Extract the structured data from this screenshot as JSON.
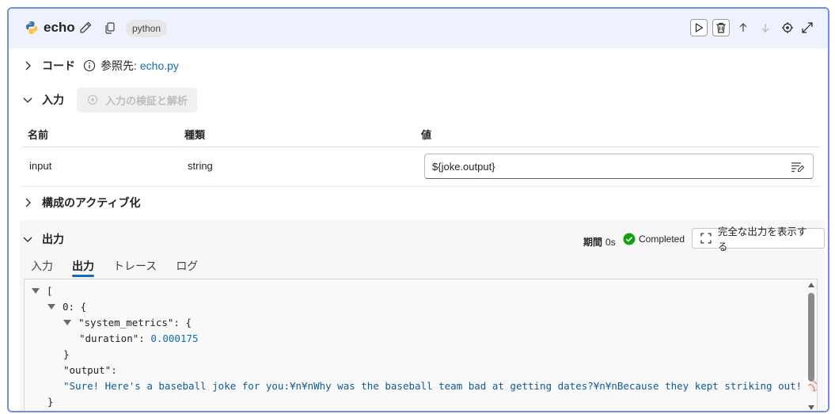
{
  "node": {
    "name": "echo",
    "language_badge": "python",
    "icons": [
      "python-logo",
      "pencil-icon",
      "copy-icon",
      "play-icon",
      "trash-icon",
      "arrow-up-icon",
      "arrow-down-icon",
      "target-icon",
      "expand-icon"
    ]
  },
  "code_section": {
    "title": "コード",
    "ref_label": "参照先:",
    "ref_link": "echo.py"
  },
  "input_section": {
    "title": "入力",
    "validate_button": "入力の検証と解析",
    "columns": {
      "name": "名前",
      "type": "種類",
      "value": "値"
    },
    "rows": [
      {
        "name": "input",
        "type": "string",
        "value": "${joke.output}"
      }
    ]
  },
  "config_section": {
    "title": "構成のアクティブ化"
  },
  "output_section": {
    "title": "出力",
    "duration_label": "期間",
    "duration_value": "0s",
    "status": "Completed",
    "status_color": "#13a10e",
    "full_output_button": "完全な出力を表示する",
    "tabs": [
      "入力",
      "出力",
      "トレース",
      "ログ"
    ],
    "active_tab": "出力",
    "json_view": {
      "open_bracket": "[",
      "index_key": "0:",
      "open_brace": "{",
      "system_metrics_key": "\"system_metrics\":",
      "sm_open_brace": "{",
      "duration_key": "\"duration\":",
      "duration_val": "0.000175",
      "sm_close_brace": "}",
      "output_key": "\"output\":",
      "output_val": "\"Sure! Here's a baseball joke for you:¥n¥nWhy was the baseball team bad at getting dates?¥n¥nBecause they kept striking out! ⚾😄\"",
      "close_brace": "}"
    }
  },
  "colors": {
    "accent": "#0f6cbd",
    "card_border": "#6f8ee8",
    "header_bg": "#edf2fd"
  }
}
